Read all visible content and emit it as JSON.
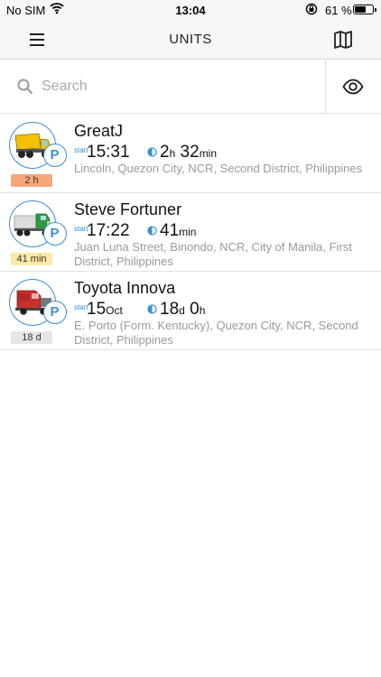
{
  "status_bar": {
    "carrier": "No SIM",
    "time": "13:04",
    "battery_percent": "61 %",
    "battery_level": 0.61
  },
  "nav": {
    "title": "UNITS",
    "left_icon": "hamburger-menu-icon",
    "right_icon": "map-icon"
  },
  "search": {
    "placeholder": "Search",
    "value": "",
    "right_icon": "eye-icon"
  },
  "units": [
    {
      "name": "GreatJ",
      "start_label": "start",
      "start_main": "15:31",
      "start_unit": "",
      "duration": [
        {
          "num": "2",
          "unit": "h"
        },
        {
          "num": " 32",
          "unit": "min"
        }
      ],
      "address": "Lincoln, Quezon City, NCR, Second District, Philippines",
      "badge": "2 h",
      "badge_color": "#f5a77a",
      "vehicle": "dump-truck-icon",
      "vehicle_color": "#f2c200",
      "parking": "P"
    },
    {
      "name": "Steve Fortuner",
      "start_label": "start",
      "start_main": "17:22",
      "start_unit": "",
      "duration": [
        {
          "num": "41",
          "unit": "min"
        }
      ],
      "address": "Juan Luna Street, Binondo, NCR, City of Manila, First District, Philippines",
      "badge": "41 min",
      "badge_color": "#fbe9a6",
      "vehicle": "semi-truck-icon",
      "vehicle_color": "#2e9b3f",
      "parking": "P"
    },
    {
      "name": "Toyota Innova",
      "start_label": "start",
      "start_main": "15",
      "start_unit": "Oct",
      "duration": [
        {
          "num": "18",
          "unit": "d"
        },
        {
          "num": " 0",
          "unit": "h"
        }
      ],
      "address": "E. Porto (Form. Kentucky), Quezon City, NCR, Second District, Philippines",
      "badge": "18 d",
      "badge_color": "#e6e6e6",
      "vehicle": "semi-truck-icon",
      "vehicle_color": "#c9302c",
      "parking": "P"
    }
  ]
}
